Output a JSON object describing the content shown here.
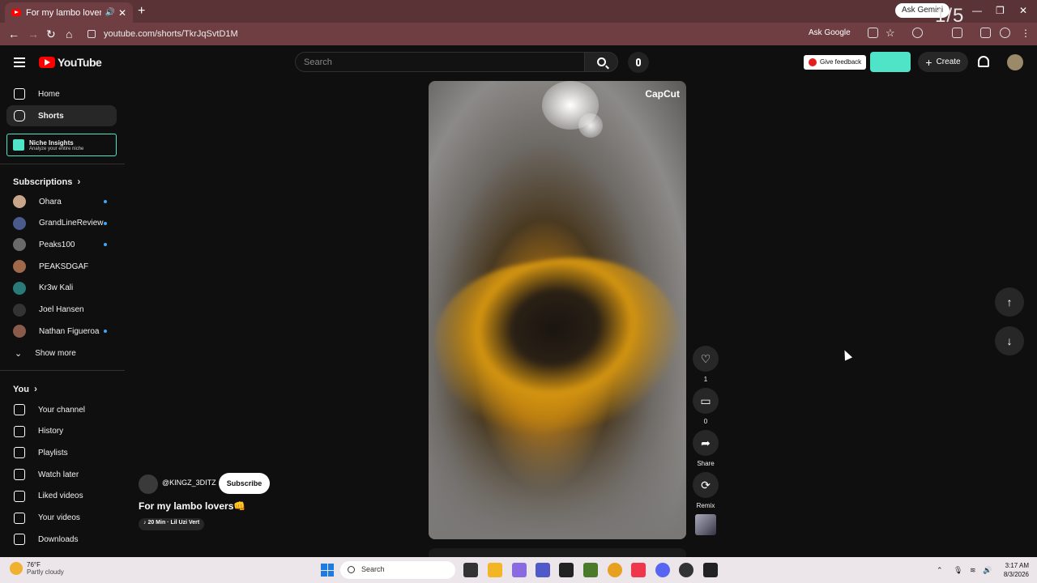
{
  "browser": {
    "tab_title": "For my lambo lovers👊 - Yo",
    "tab_audio_icon": "speaker-icon",
    "new_tab_label": "+",
    "url": "youtube.com/shorts/TkrJqSvtD1M",
    "ask_gemini": "Ask Gemini",
    "ask_google": "Ask Google",
    "overlay_counter": "1/5"
  },
  "header": {
    "logo_text": "YouTube",
    "search_placeholder": "Search",
    "give_feedback": "Give feedback",
    "create_label": "Create"
  },
  "sidebar": {
    "main": [
      {
        "label": "Home",
        "icon": "home-icon"
      },
      {
        "label": "Shorts",
        "icon": "shorts-icon"
      }
    ],
    "niche": {
      "title": "Niche Insights",
      "subtitle": "Analyze your entire niche"
    },
    "subscriptions_title": "Subscriptions",
    "subscriptions": [
      {
        "label": "Ohara",
        "color": "#c9a58a",
        "new": true
      },
      {
        "label": "GrandLineReview",
        "color": "#4a5a8a",
        "new": true
      },
      {
        "label": "Peaks100",
        "color": "#6a6a6a",
        "new": true
      },
      {
        "label": "PEAKSDGAF",
        "color": "#a06a4a",
        "new": false
      },
      {
        "label": "Kr3w Kali",
        "color": "#2a7a7a",
        "new": false
      },
      {
        "label": "Joel Hansen",
        "color": "#333333",
        "new": false
      },
      {
        "label": "Nathan Figueroa",
        "color": "#8a5a4a",
        "new": true
      }
    ],
    "show_more": "Show more",
    "you_title": "You",
    "you_items": [
      {
        "label": "Your channel",
        "icon": "channel-icon"
      },
      {
        "label": "History",
        "icon": "history-icon"
      },
      {
        "label": "Playlists",
        "icon": "playlists-icon"
      },
      {
        "label": "Watch later",
        "icon": "clock-icon"
      },
      {
        "label": "Liked videos",
        "icon": "thumbs-up-icon"
      },
      {
        "label": "Your videos",
        "icon": "video-icon"
      },
      {
        "label": "Downloads",
        "icon": "download-icon"
      }
    ]
  },
  "short": {
    "watermark": "CapCut",
    "channel": "@KINGZ_3DITZ",
    "subscribe_label": "Subscribe",
    "title": "For my lambo lovers👊",
    "music": "♪ 20 Min · Lil Uzi Vert",
    "actions": {
      "like_count": "1",
      "comment_count": "0",
      "share_label": "Share",
      "remix_label": "Remix"
    }
  },
  "taskbar": {
    "temperature": "76°F",
    "condition": "Partly cloudy",
    "search_label": "Search",
    "time": "3:17 AM",
    "date": "8/3/2026"
  }
}
